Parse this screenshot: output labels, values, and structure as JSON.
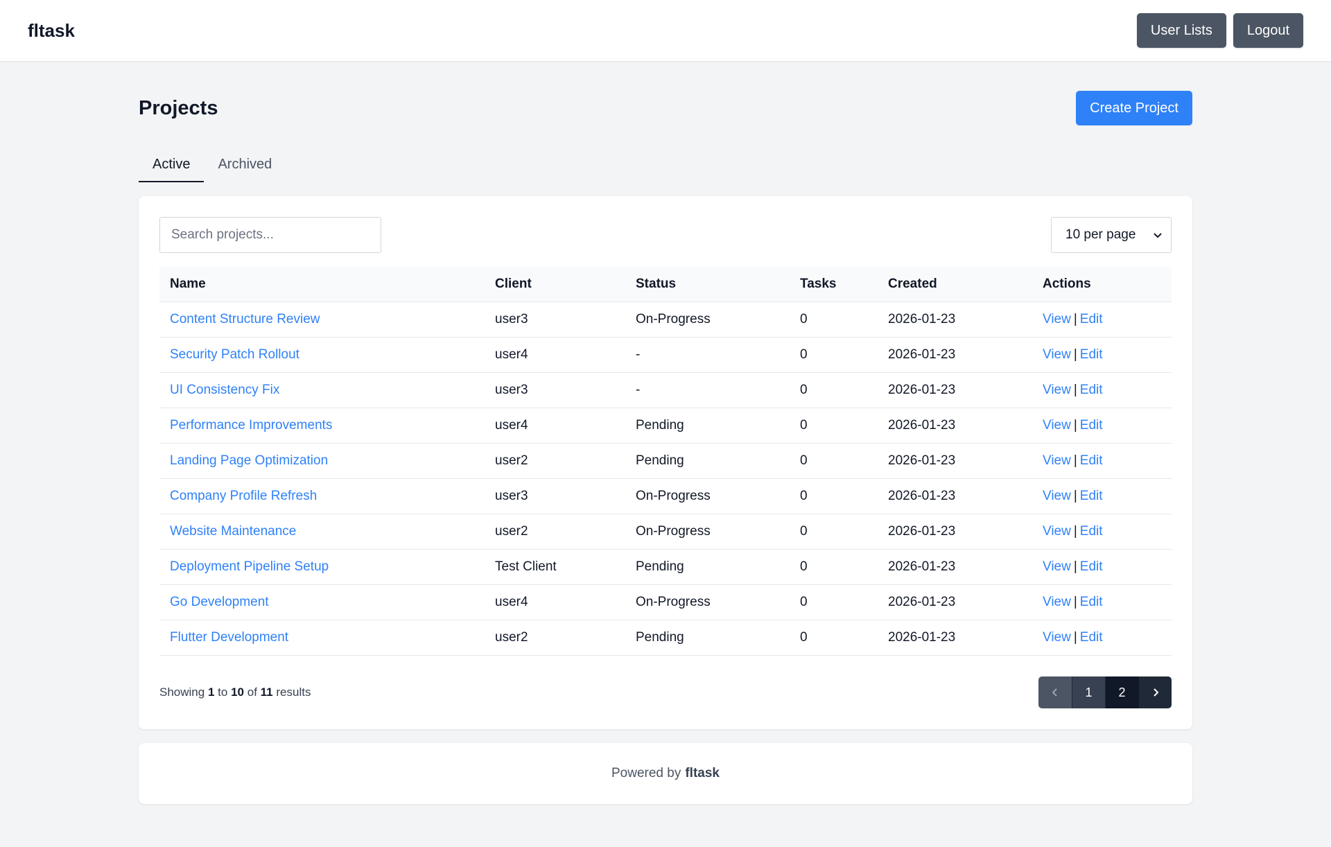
{
  "header": {
    "brand": "fltask",
    "user_lists_label": "User Lists",
    "logout_label": "Logout"
  },
  "page": {
    "title": "Projects",
    "create_label": "Create Project"
  },
  "tabs": [
    {
      "label": "Active",
      "active": true
    },
    {
      "label": "Archived",
      "active": false
    }
  ],
  "toolbar": {
    "search_placeholder": "Search projects...",
    "search_value": "",
    "per_page": "10 per page"
  },
  "table": {
    "columns": [
      "Name",
      "Client",
      "Status",
      "Tasks",
      "Created",
      "Actions"
    ],
    "view_label": "View",
    "edit_label": "Edit",
    "separator": "|",
    "rows": [
      {
        "name": "Content Structure Review",
        "client": "user3",
        "status": "On-Progress",
        "tasks": "0",
        "created": "2026-01-23"
      },
      {
        "name": "Security Patch Rollout",
        "client": "user4",
        "status": "-",
        "tasks": "0",
        "created": "2026-01-23"
      },
      {
        "name": "UI Consistency Fix",
        "client": "user3",
        "status": "-",
        "tasks": "0",
        "created": "2026-01-23"
      },
      {
        "name": "Performance Improvements",
        "client": "user4",
        "status": "Pending",
        "tasks": "0",
        "created": "2026-01-23"
      },
      {
        "name": "Landing Page Optimization",
        "client": "user2",
        "status": "Pending",
        "tasks": "0",
        "created": "2026-01-23"
      },
      {
        "name": "Company Profile Refresh",
        "client": "user3",
        "status": "On-Progress",
        "tasks": "0",
        "created": "2026-01-23"
      },
      {
        "name": "Website Maintenance",
        "client": "user2",
        "status": "On-Progress",
        "tasks": "0",
        "created": "2026-01-23"
      },
      {
        "name": "Deployment Pipeline Setup",
        "client": "Test Client",
        "status": "Pending",
        "tasks": "0",
        "created": "2026-01-23"
      },
      {
        "name": "Go Development",
        "client": "user4",
        "status": "On-Progress",
        "tasks": "0",
        "created": "2026-01-23"
      },
      {
        "name": "Flutter Development",
        "client": "user2",
        "status": "Pending",
        "tasks": "0",
        "created": "2026-01-23"
      }
    ]
  },
  "pagination": {
    "showing_prefix": "Showing",
    "from": "1",
    "to_word": "to",
    "to": "10",
    "of_word": "of",
    "total": "11",
    "results_word": "results",
    "pages": [
      "1",
      "2"
    ],
    "current_page": "2"
  },
  "footer": {
    "powered_by": "Powered by",
    "brand": "fltask"
  },
  "colors": {
    "accent": "#2f81f7",
    "dark_button": "#4b5563",
    "background": "#f3f4f6"
  }
}
